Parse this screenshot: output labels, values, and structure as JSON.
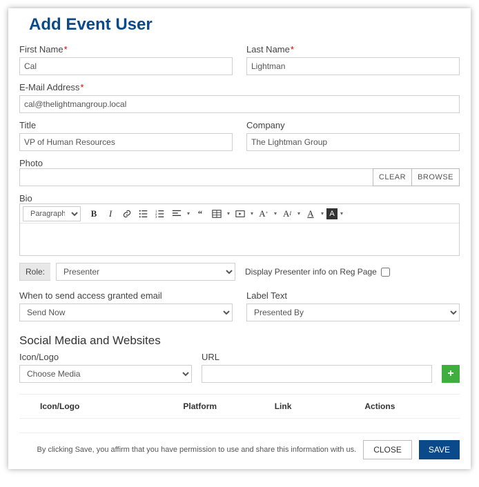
{
  "page_title": "Add Event User",
  "labels": {
    "first_name": "First Name",
    "last_name": "Last Name",
    "email": "E-Mail Address",
    "title": "Title",
    "company": "Company",
    "photo": "Photo",
    "bio": "Bio",
    "role": "Role:",
    "display_presenter": "Display Presenter info on Reg Page",
    "when_send": "When to send access granted email",
    "label_text": "Label Text",
    "icon_logo": "Icon/Logo",
    "url": "URL"
  },
  "values": {
    "first_name": "Cal",
    "last_name": "Lightman",
    "email": "cal@thelightmangroup.local",
    "title": "VP of Human Resources",
    "company": "The Lightman Group",
    "photo": "",
    "paragraph": "Paragraph",
    "role": "Presenter",
    "when_send": "Send Now",
    "label_text": "Presented By",
    "choose_media": "Choose Media",
    "url": ""
  },
  "buttons": {
    "clear": "CLEAR",
    "browse": "BROWSE",
    "close": "CLOSE",
    "save": "SAVE",
    "add": "+"
  },
  "section": {
    "social": "Social Media and Websites"
  },
  "table_headers": {
    "icon_logo": "Icon/Logo",
    "platform": "Platform",
    "link": "Link",
    "actions": "Actions"
  },
  "footer_disclaimer": "By clicking Save, you affirm that you have permission to use and share this information with us."
}
